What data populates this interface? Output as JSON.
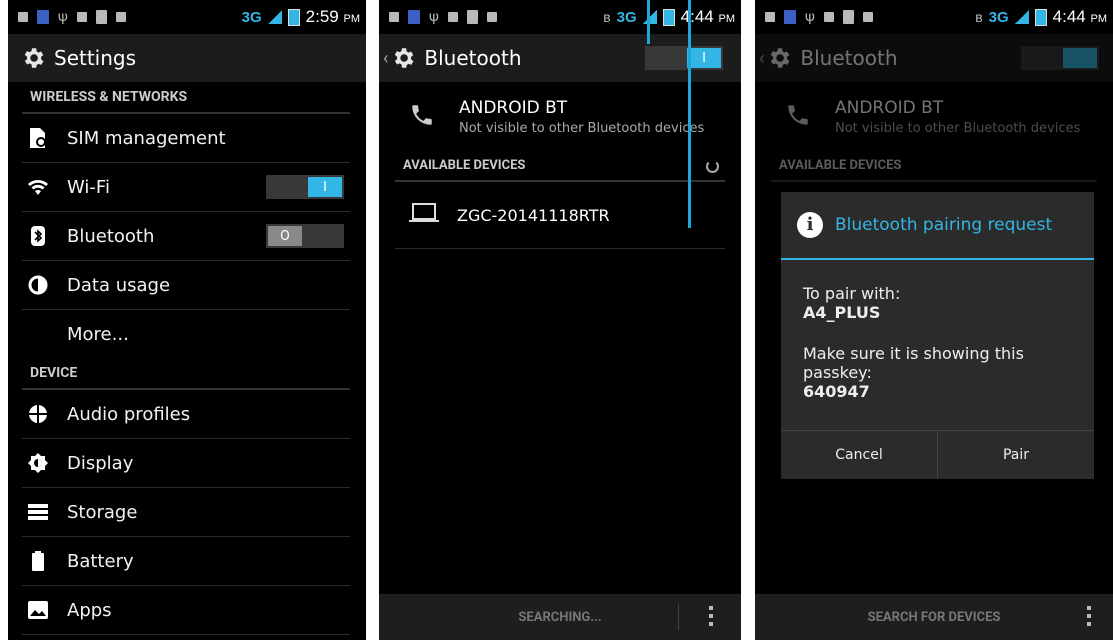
{
  "screen1": {
    "status": {
      "network": "3G",
      "time": "2:59",
      "ampm": "PM"
    },
    "title": "Settings",
    "sections": [
      {
        "header": "WIRELESS & NETWORKS"
      },
      {
        "header": "DEVICE"
      }
    ],
    "items": {
      "sim": "SIM management",
      "wifi": "Wi-Fi",
      "bluetooth": "Bluetooth",
      "data": "Data usage",
      "more": "More...",
      "audio": "Audio profiles",
      "display": "Display",
      "storage": "Storage",
      "battery": "Battery",
      "apps": "Apps"
    },
    "wifi_switch": "I",
    "bt_switch": "O"
  },
  "screen2": {
    "status": {
      "network": "3G",
      "time": "4:44",
      "ampm": "PM"
    },
    "title": "Bluetooth",
    "switch": "I",
    "own_name": "ANDROID BT",
    "own_sub": "Not visible to other Bluetooth devices",
    "available_header": "AVAILABLE DEVICES",
    "device": "ZGC-20141118RTR",
    "bottom_label": "SEARCHING..."
  },
  "screen3": {
    "status": {
      "network": "3G",
      "time": "4:44",
      "ampm": "PM"
    },
    "title": "Bluetooth",
    "own_name": "ANDROID BT",
    "own_sub": "Not visible to other Bluetooth devices",
    "available_header": "AVAILABLE DEVICES",
    "bottom_label": "SEARCH FOR DEVICES",
    "dialog": {
      "title": "Bluetooth pairing request",
      "line1": "To pair with:",
      "device": "A4_PLUS",
      "line2": "Make sure it is showing this passkey:",
      "passkey": "640947",
      "cancel": "Cancel",
      "pair": "Pair"
    }
  }
}
